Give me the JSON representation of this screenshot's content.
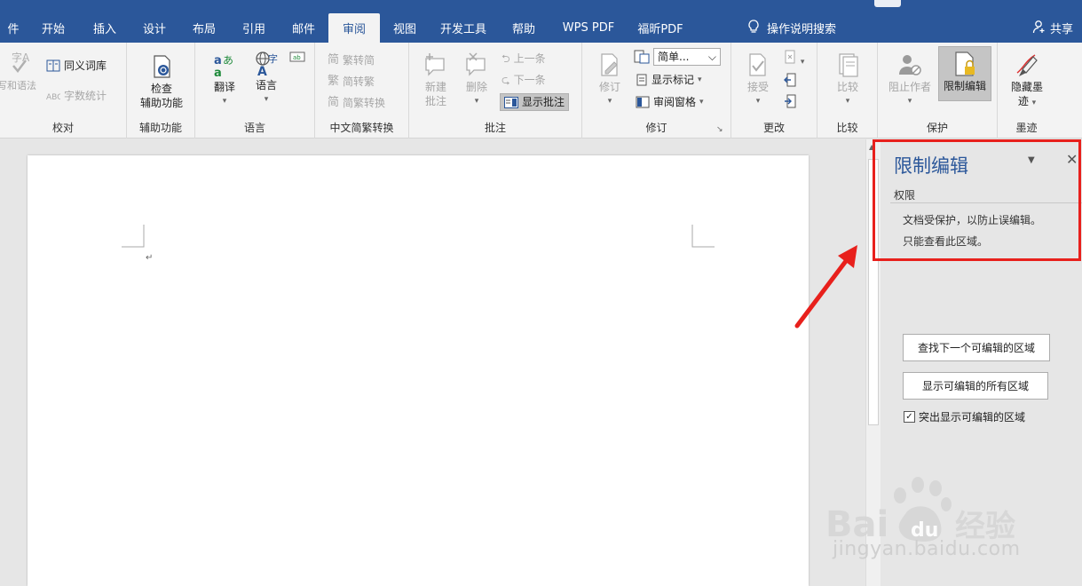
{
  "tabs": [
    "件",
    "开始",
    "插入",
    "设计",
    "布局",
    "引用",
    "邮件",
    "审阅",
    "视图",
    "开发工具",
    "帮助",
    "WPS PDF",
    "福昕PDF"
  ],
  "active_tab": "审阅",
  "tell_me": "操作说明搜索",
  "share": "共享",
  "ribbon": {
    "proofing": {
      "label": "校对",
      "spell_grammar": "拼写和语法",
      "thesaurus": "同义词库",
      "word_count": "字数统计"
    },
    "accessibility": {
      "label": "辅助功能",
      "check_line1": "检查",
      "check_line2": "辅助功能"
    },
    "language": {
      "label": "语言",
      "translate": "翻译",
      "language": "语言"
    },
    "chinese_conversion": {
      "label": "中文简繁转换",
      "to_simplified": "繁转简",
      "to_traditional": "简转繁",
      "convert": "简繁转换"
    },
    "comments": {
      "label": "批注",
      "new_line1": "新建",
      "new_line2": "批注",
      "delete": "删除",
      "previous": "上一条",
      "next": "下一条",
      "show_comments": "显示批注"
    },
    "tracking": {
      "label": "修订",
      "track_changes": "修订",
      "display_markup": "简单...",
      "show_markup": "显示标记",
      "reviewing_pane": "审阅窗格"
    },
    "changes": {
      "label": "更改",
      "accept": "接受"
    },
    "compare": {
      "label": "比较",
      "compare": "比较"
    },
    "protect": {
      "label": "保护",
      "block_authors": "阻止作者",
      "restrict_editing": "限制编辑"
    },
    "ink": {
      "label": "墨迹",
      "hide_ink_line1": "隐藏墨",
      "hide_ink_line2": "迹"
    }
  },
  "pane": {
    "title": "限制编辑",
    "section": "权限",
    "message_line1": "文档受保护，以防止误编辑。",
    "message_line2": "只能查看此区域。",
    "find_next_btn": "查找下一个可编辑的区域",
    "show_all_btn": "显示可编辑的所有区域",
    "highlight_label": "突出显示可编辑的区域",
    "highlight_checked": true
  },
  "watermark": {
    "text": "jingyan.baidu.com",
    "logo_text": "Bai du 经验"
  },
  "colors": {
    "accent": "#2b579a",
    "annotation_red": "#e8201c"
  }
}
